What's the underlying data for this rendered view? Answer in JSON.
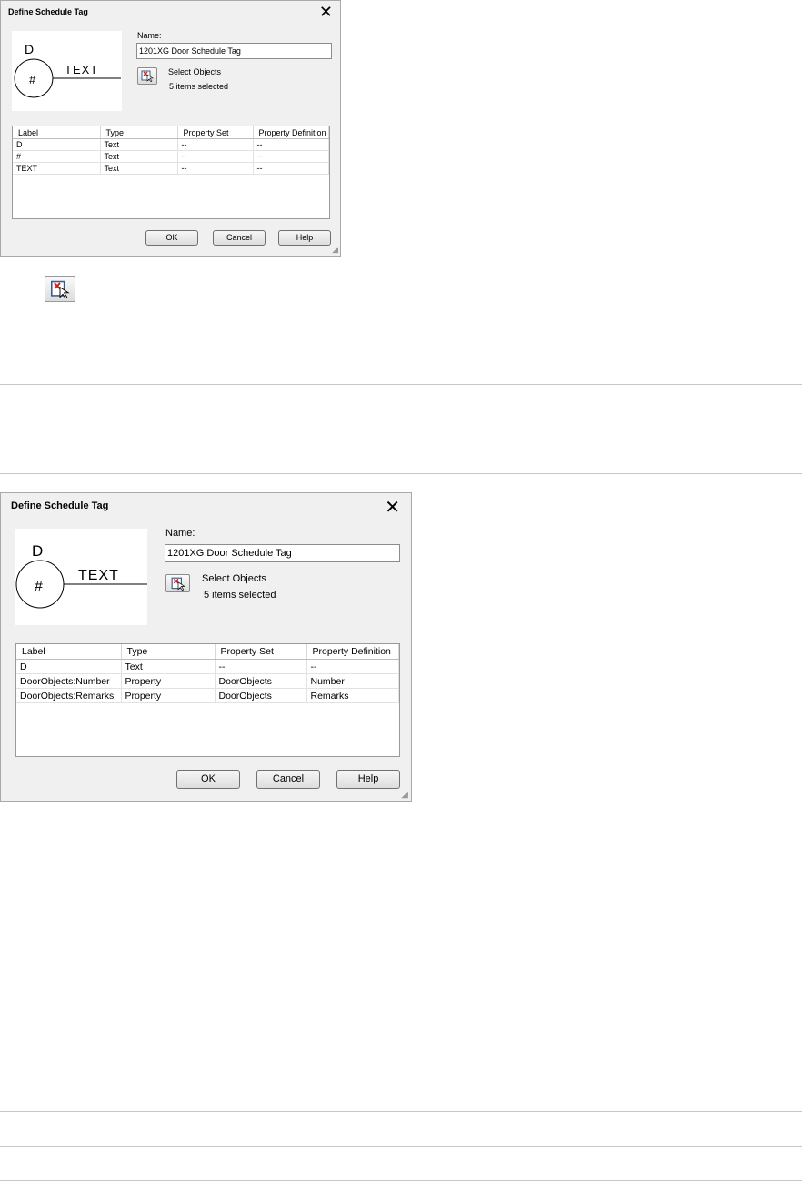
{
  "dialog_top": {
    "title": "Define Schedule Tag",
    "close_glyph": "✕",
    "preview": {
      "label_d": "D",
      "label_hash": "#",
      "label_text": "TEXT"
    },
    "name_label": "Name:",
    "name_value": "1201XG Door Schedule Tag",
    "select_label": "Select Objects",
    "select_icon": "select-objects-icon",
    "selected_count": "5 items selected",
    "columns": [
      "Label",
      "Type",
      "Property Set",
      "Property Definition"
    ],
    "rows": [
      [
        "D",
        "Text",
        "--",
        "--"
      ],
      [
        "#",
        "Text",
        "--",
        "--"
      ],
      [
        "TEXT",
        "Text",
        "--",
        "--"
      ]
    ],
    "buttons": {
      "ok": "OK",
      "cancel": "Cancel",
      "help": "Help"
    }
  },
  "standalone_icon": "select-objects-icon",
  "dialog_bottom": {
    "title": "Define Schedule Tag",
    "close_glyph": "✕",
    "preview": {
      "label_d": "D",
      "label_hash": "#",
      "label_text": "TEXT"
    },
    "name_label": "Name:",
    "name_value": "1201XG Door Schedule Tag",
    "select_label": "Select Objects",
    "select_icon": "select-objects-icon",
    "selected_count": "5 items selected",
    "columns": [
      "Label",
      "Type",
      "Property Set",
      "Property Definition"
    ],
    "rows": [
      [
        "D",
        "Text",
        "--",
        "--"
      ],
      [
        "DoorObjects:Number",
        "Property",
        "DoorObjects",
        "Number"
      ],
      [
        "DoorObjects:Remarks",
        "Property",
        "DoorObjects",
        "Remarks"
      ]
    ],
    "buttons": {
      "ok": "OK",
      "cancel": "Cancel",
      "help": "Help"
    }
  },
  "colors": {
    "dialog_bg": "#f0f0f0",
    "rule": "#c8c8c8",
    "icon_accent": "#d02020"
  }
}
